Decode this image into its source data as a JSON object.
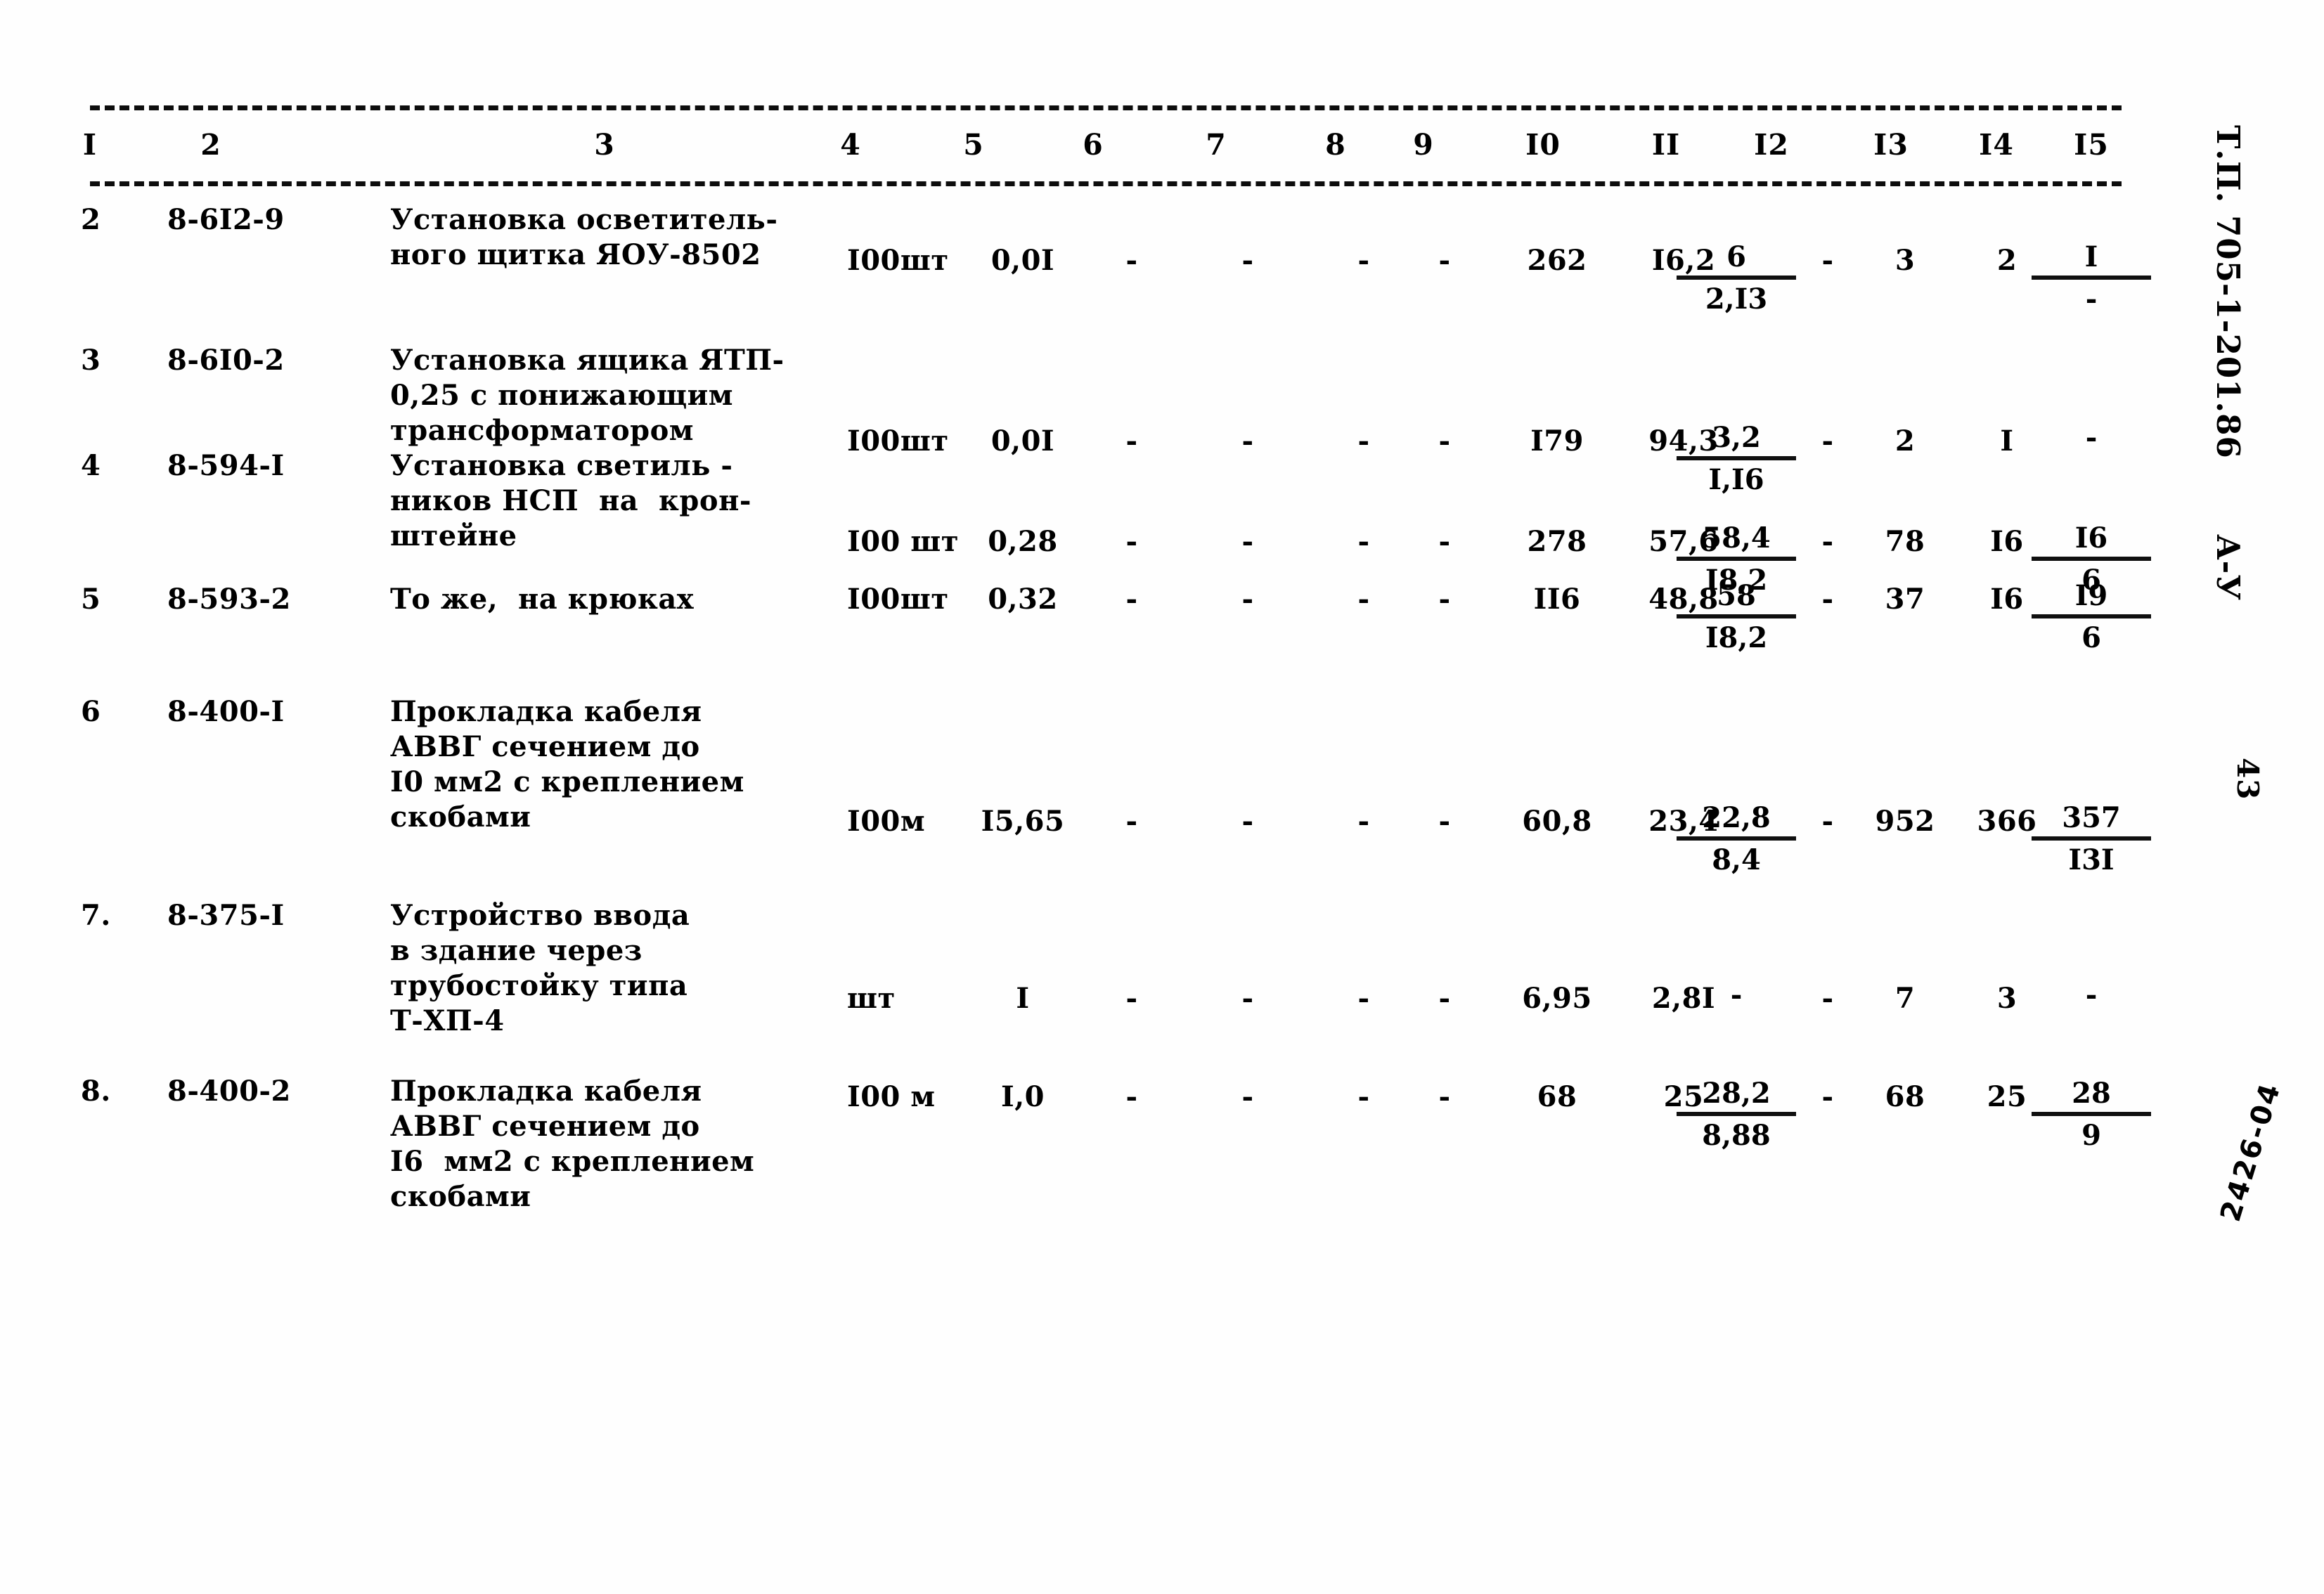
{
  "document": {
    "kind": "scanned-estimate-table",
    "stamps": {
      "project_code": "Т.П. 705-1-201.86",
      "series_mark": "А-У",
      "page_number": "43",
      "archive_number": "2426-04"
    }
  },
  "table": {
    "column_headers": [
      "I",
      "2",
      "3",
      "4",
      "5",
      "6",
      "7",
      "8",
      "9",
      "I0",
      "II",
      "I2",
      "I3",
      "I4",
      "I5"
    ],
    "rows": [
      {
        "num": "2",
        "code": "8-6I2-9",
        "desc": [
          "Установка осветитель-",
          "ного щитка ЯОУ-8502"
        ],
        "unit": "I00шт",
        "c5": "0,0I",
        "c6": "-",
        "c7": "-",
        "c8": "-",
        "c9": "-",
        "c10": "262",
        "c11": "I6,2",
        "c12_num": "6",
        "c12_den": "2,I3",
        "c13": "-",
        "c14": "3",
        "c15": "2",
        "c16_num": "I",
        "c16_den": "-"
      },
      {
        "num": "3",
        "code": "8-6I0-2",
        "desc": [
          "Установка ящика ЯТП-",
          "0,25 с понижающим",
          "трансформатором"
        ],
        "unit": "I00шт",
        "c5": "0,0I",
        "c6": "-",
        "c7": "-",
        "c8": "-",
        "c9": "-",
        "c10": "I79",
        "c11": "94,3",
        "c12_num": "3,2",
        "c12_den": "I,I6",
        "c13": "-",
        "c14": "2",
        "c15": "I",
        "c16_num": "-",
        "c16_den": ""
      },
      {
        "num": "4",
        "code": "8-594-I",
        "desc": [
          "Установка светиль -",
          "ников НСП  на  крон-",
          "штейне"
        ],
        "unit": "I00 шт",
        "c5": "0,28",
        "c6": "-",
        "c7": "-",
        "c8": "-",
        "c9": "-",
        "c10": "278",
        "c11": "57,6",
        "c12_num": "58,4",
        "c12_den": "I8,2",
        "c13": "-",
        "c14": "78",
        "c15": "I6",
        "c16_num": "I6",
        "c16_den": "6"
      },
      {
        "num": "5",
        "code": "8-593-2",
        "desc": [
          "То же,  на крюках"
        ],
        "unit": "I00шт",
        "c5": "0,32",
        "c6": "-",
        "c7": "-",
        "c8": "-",
        "c9": "-",
        "c10": "II6",
        "c11": "48,8",
        "c12_num": "58",
        "c12_den": "I8,2",
        "c13": "-",
        "c14": "37",
        "c15": "I6",
        "c16_num": "I9",
        "c16_den": "6"
      },
      {
        "num": "6",
        "code": "8-400-I",
        "desc": [
          "Прокладка кабеля",
          "АВВГ сечением до",
          "I0 мм2 с креплением",
          "скобами"
        ],
        "unit": "I00м",
        "c5": "I5,65",
        "c6": "-",
        "c7": "-",
        "c8": "-",
        "c9": "-",
        "c10": "60,8",
        "c11": "23,4",
        "c12_num": "22,8",
        "c12_den": "8,4",
        "c13": "-",
        "c14": "952",
        "c15": "366",
        "c16_num": "357",
        "c16_den": "I3I"
      },
      {
        "num": "7.",
        "code": "8-375-I",
        "desc": [
          "Устройство ввода",
          "в здание через",
          "трубостойку типа",
          "Т-ХП-4"
        ],
        "unit": "шт",
        "c5": "I",
        "c6": "-",
        "c7": "-",
        "c8": "-",
        "c9": "-",
        "c10": "6,95",
        "c11": "2,8I",
        "c12_num": "-",
        "c12_den": "",
        "c13": "-",
        "c14": "7",
        "c15": "3",
        "c16_num": "-",
        "c16_den": ""
      },
      {
        "num": "8.",
        "code": "8-400-2",
        "desc": [
          "Прокладка кабеля",
          "АВВГ сечением до",
          "I6  мм2 с креплением",
          "скобами"
        ],
        "unit": "I00 м",
        "c5": "I,0",
        "c6": "-",
        "c7": "-",
        "c8": "-",
        "c9": "-",
        "c10": "68",
        "c11": "25",
        "c12_num": "28,2",
        "c12_den": "8,88",
        "c13": "-",
        "c14": "68",
        "c15": "25",
        "c16_num": "28",
        "c16_den": "9"
      }
    ]
  }
}
